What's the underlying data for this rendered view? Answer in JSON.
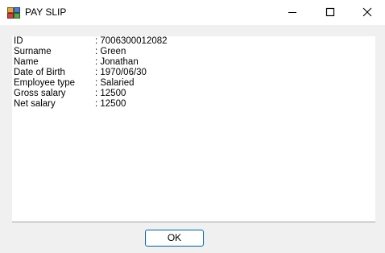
{
  "window": {
    "title": "PAY SLIP",
    "icon": "app-window-icon",
    "controls": {
      "minimize_icon": "minimize-icon",
      "maximize_icon": "maximize-icon",
      "close_icon": "close-icon"
    }
  },
  "payslip": {
    "rows": [
      {
        "label": "ID",
        "value": ": 7006300012082"
      },
      {
        "label": "Surname",
        "value": ": Green"
      },
      {
        "label": "Name",
        "value": ": Jonathan"
      },
      {
        "label": "Date of Birth",
        "value": ": 1970/06/30"
      },
      {
        "label": "Employee type",
        "value": ": Salaried"
      },
      {
        "label": "Gross salary",
        "value": ": 12500"
      },
      {
        "label": "Net salary",
        "value": ": 12500"
      }
    ]
  },
  "footer": {
    "ok_label": "OK"
  },
  "colors": {
    "accent": "#0067c0",
    "dialog_background": "#f0f0f0",
    "text_background": "#ffffff"
  }
}
